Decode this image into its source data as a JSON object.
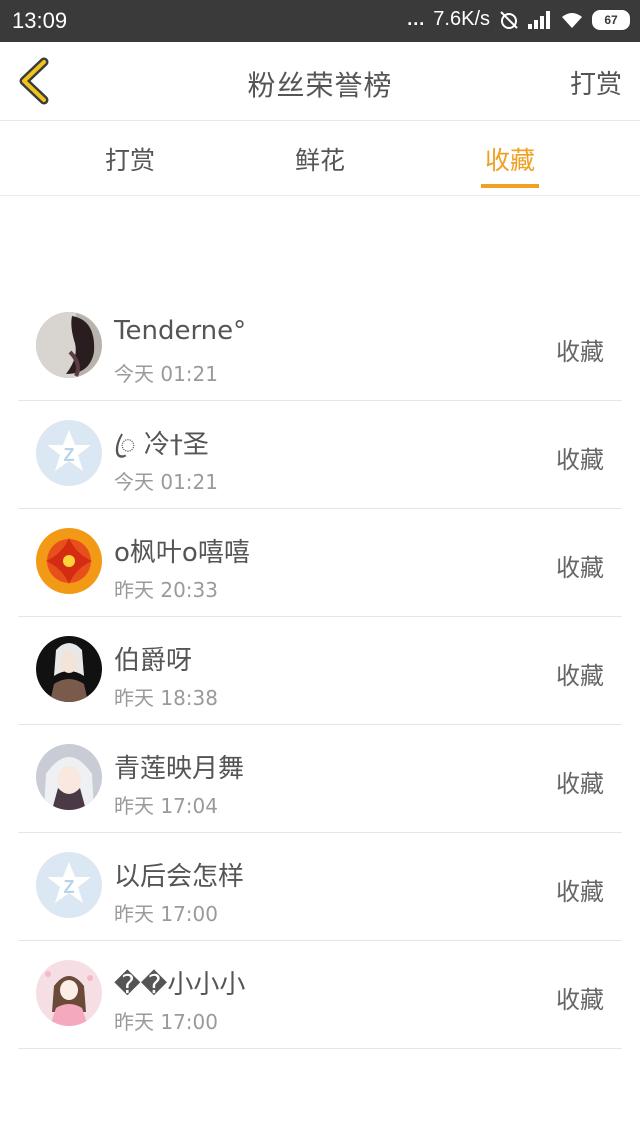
{
  "status": {
    "time": "13:09",
    "dots": "...",
    "speed": "7.6K/s",
    "battery": "67"
  },
  "header": {
    "title": "粉丝荣誉榜",
    "action": "打赏"
  },
  "tabs": [
    {
      "label": "打赏",
      "active": false
    },
    {
      "label": "鲜花",
      "active": false
    },
    {
      "label": "收藏",
      "active": true
    }
  ],
  "colors": {
    "accent": "#f0a022",
    "statusbar": "#3a3a3a"
  },
  "list": [
    {
      "name": "Tenderne°",
      "time": "今天 01:21",
      "action": "收藏",
      "avatar": "dark-hair-photo"
    },
    {
      "name": "ꦿ 冷†圣",
      "time": "今天 01:21",
      "action": "收藏",
      "avatar": "default-qq-avatar"
    },
    {
      "name": "o枫叶o嘻嘻",
      "time": "昨天 20:33",
      "action": "收藏",
      "avatar": "red-flower-photo"
    },
    {
      "name": "伯爵呀",
      "time": "昨天 18:38",
      "action": "收藏",
      "avatar": "anime-man-avatar"
    },
    {
      "name": "青莲映月舞",
      "time": "昨天 17:04",
      "action": "收藏",
      "avatar": "anime-girl-avatar"
    },
    {
      "name": "以后会怎样",
      "time": "昨天 17:00",
      "action": "收藏",
      "avatar": "default-qq-avatar"
    },
    {
      "name": "��小小小",
      "time": "昨天 17:00",
      "action": "收藏",
      "avatar": "cartoon-girl-avatar"
    }
  ]
}
